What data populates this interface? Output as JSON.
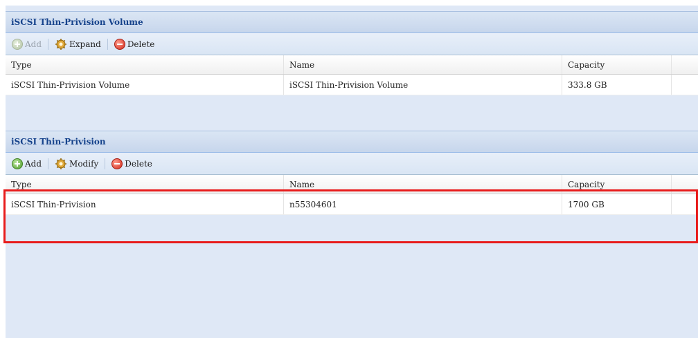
{
  "volume_panel": {
    "title": "iSCSI Thin-Privision Volume",
    "toolbar": {
      "add_label": "Add",
      "expand_label": "Expand",
      "delete_label": "Delete"
    },
    "columns": [
      "Type",
      "Name",
      "Capacity"
    ],
    "rows": [
      {
        "type": "iSCSI Thin-Privision Volume",
        "name": "iSCSI Thin-Privision Volume",
        "capacity": "333.8 GB"
      }
    ]
  },
  "target_panel": {
    "title": "iSCSI Thin-Privision",
    "toolbar": {
      "add_label": "Add",
      "modify_label": "Modify",
      "delete_label": "Delete"
    },
    "columns": [
      "Type",
      "Name",
      "Capacity"
    ],
    "rows": [
      {
        "type": "iSCSI Thin-Privision",
        "name": "n55304601",
        "capacity": "1700 GB"
      }
    ]
  },
  "colors": {
    "header_text": "#15428b",
    "background": "#dfe8f6",
    "highlight": "#e81b1b"
  },
  "icons": [
    "add-icon",
    "gear-icon",
    "delete-icon"
  ]
}
